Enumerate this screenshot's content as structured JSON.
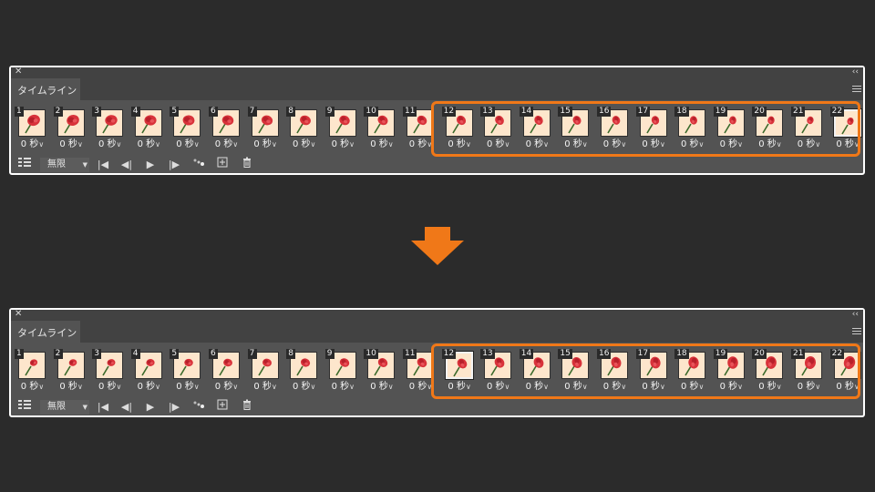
{
  "panels": [
    {
      "tab_label": "タイムライン",
      "selected_frame": 22,
      "frames": [
        {
          "number": "1",
          "delay": "0 秒"
        },
        {
          "number": "2",
          "delay": "0 秒"
        },
        {
          "number": "3",
          "delay": "0 秒"
        },
        {
          "number": "4",
          "delay": "0 秒"
        },
        {
          "number": "5",
          "delay": "0 秒"
        },
        {
          "number": "6",
          "delay": "0 秒"
        },
        {
          "number": "7",
          "delay": "0 秒"
        },
        {
          "number": "8",
          "delay": "0 秒"
        },
        {
          "number": "9",
          "delay": "0 秒"
        },
        {
          "number": "10",
          "delay": "0 秒"
        },
        {
          "number": "11",
          "delay": "0 秒"
        },
        {
          "number": "12",
          "delay": "0 秒"
        },
        {
          "number": "13",
          "delay": "0 秒"
        },
        {
          "number": "14",
          "delay": "0 秒"
        },
        {
          "number": "15",
          "delay": "0 秒"
        },
        {
          "number": "16",
          "delay": "0 秒"
        },
        {
          "number": "17",
          "delay": "0 秒"
        },
        {
          "number": "18",
          "delay": "0 秒"
        },
        {
          "number": "19",
          "delay": "0 秒"
        },
        {
          "number": "20",
          "delay": "0 秒"
        },
        {
          "number": "21",
          "delay": "0 秒"
        },
        {
          "number": "22",
          "delay": "0 秒"
        }
      ],
      "loop_option": "無限"
    },
    {
      "tab_label": "タイムライン",
      "selected_frame": 12,
      "frames": [
        {
          "number": "1",
          "delay": "0 秒"
        },
        {
          "number": "2",
          "delay": "0 秒"
        },
        {
          "number": "3",
          "delay": "0 秒"
        },
        {
          "number": "4",
          "delay": "0 秒"
        },
        {
          "number": "5",
          "delay": "0 秒"
        },
        {
          "number": "6",
          "delay": "0 秒"
        },
        {
          "number": "7",
          "delay": "0 秒"
        },
        {
          "number": "8",
          "delay": "0 秒"
        },
        {
          "number": "9",
          "delay": "0 秒"
        },
        {
          "number": "10",
          "delay": "0 秒"
        },
        {
          "number": "11",
          "delay": "0 秒"
        },
        {
          "number": "12",
          "delay": "0 秒"
        },
        {
          "number": "13",
          "delay": "0 秒"
        },
        {
          "number": "14",
          "delay": "0 秒"
        },
        {
          "number": "15",
          "delay": "0 秒"
        },
        {
          "number": "16",
          "delay": "0 秒"
        },
        {
          "number": "17",
          "delay": "0 秒"
        },
        {
          "number": "18",
          "delay": "0 秒"
        },
        {
          "number": "19",
          "delay": "0 秒"
        },
        {
          "number": "20",
          "delay": "0 秒"
        },
        {
          "number": "21",
          "delay": "0 秒"
        },
        {
          "number": "22",
          "delay": "0 秒"
        }
      ],
      "loop_option": "無限"
    }
  ],
  "icons": {
    "close": "close-icon",
    "collapse": "collapse-icon",
    "panel_menu": "panel-menu-icon",
    "convert": "convert-to-video-timeline-icon",
    "first_frame": "first-frame-icon",
    "previous_frame": "previous-frame-icon",
    "play": "play-icon",
    "next_frame": "next-frame-icon",
    "tween": "tween-icon",
    "duplicate": "duplicate-frame-icon",
    "delete": "trash-icon",
    "transition_arrow": "arrow-down-icon"
  },
  "colors": {
    "background": "#2b2b2b",
    "panel": "#535353",
    "highlight": "#f07818",
    "arrow": "#f07818",
    "thumbnail_bg": "#fde6cc",
    "rose": "#d8323a"
  }
}
